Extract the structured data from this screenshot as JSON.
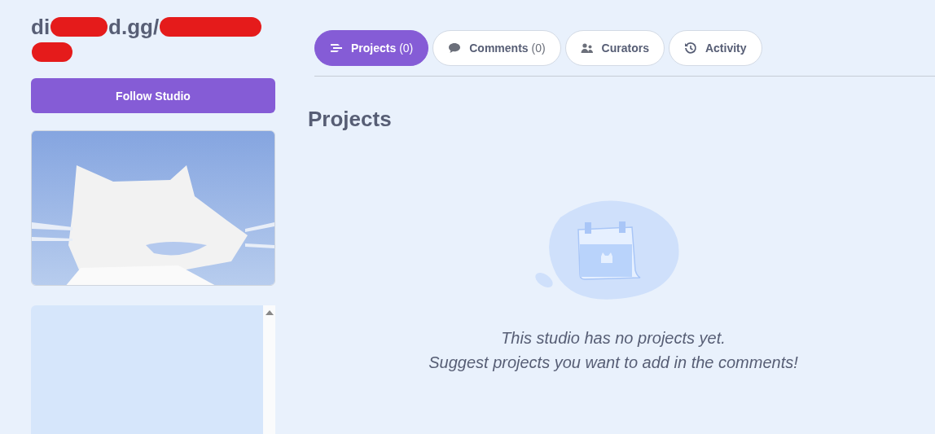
{
  "studio": {
    "title_parts": [
      {
        "kind": "text",
        "text": "di"
      },
      {
        "kind": "redaction"
      },
      {
        "kind": "text",
        "text": "d.gg/"
      },
      {
        "kind": "redaction"
      },
      {
        "kind": "break"
      },
      {
        "kind": "redaction"
      }
    ],
    "follow_button": "Follow Studio"
  },
  "tabs": [
    {
      "label": "Projects",
      "count": "(0)",
      "selected": true
    },
    {
      "label": "Comments",
      "count": "(0)",
      "selected": false
    },
    {
      "label": "Curators",
      "selected": false
    },
    {
      "label": "Activity",
      "selected": false
    }
  ],
  "section": {
    "heading": "Projects",
    "empty_lines": [
      "This studio has no projects yet.",
      "Suggest projects you want to add in the comments!"
    ]
  }
}
